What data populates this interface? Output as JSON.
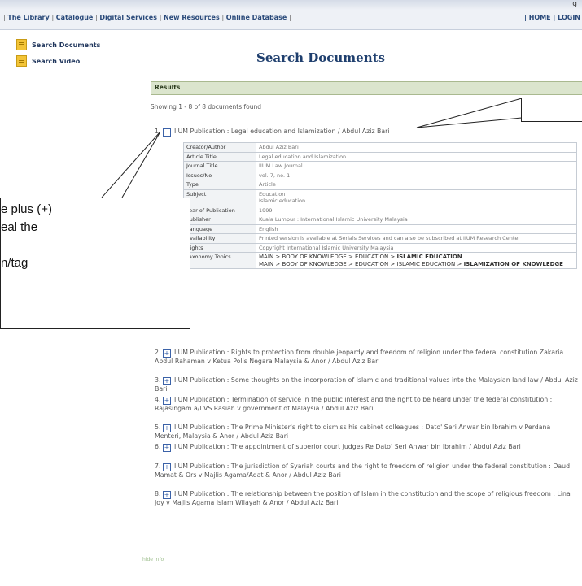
{
  "header": {
    "cutoff_text": "g",
    "nav": [
      "The Library",
      "Catalogue",
      "Digital Services",
      "New Resources",
      "Online Database"
    ],
    "right_links": [
      "HOME",
      "LOGIN"
    ]
  },
  "sidebar": {
    "items": [
      {
        "label": "Search Documents",
        "icon": "document-icon"
      },
      {
        "label": "Search Video",
        "icon": "document-icon"
      }
    ]
  },
  "main": {
    "title": "Search Documents",
    "results_header": "Results",
    "showing": "Showing 1 - 8 of 8 documents found"
  },
  "results": [
    {
      "num": "1.",
      "text": "IIUM Publication : Legal education and Islamization / Abdul Aziz Bari"
    },
    {
      "num": "2.",
      "text": "IIUM Publication : Rights to protection from double jeopardy and freedom of religion under the federal constitution Zakaria Abdul Rahaman v Ketua Polis Negara Malaysia & Anor / Abdul Aziz Bari"
    },
    {
      "num": "3.",
      "text": "IIUM Publication : Some thoughts on the incorporation of Islamic and traditional values into the Malaysian land law / Abdul Aziz Bari"
    },
    {
      "num": "4.",
      "text": "IIUM Publication : Termination of service in the public interest and the right to be heard under the federal constitution : Rajasingam a/l VS Rasiah v government of Malaysia / Abdul Aziz Bari"
    },
    {
      "num": "5.",
      "text": "IIUM Publication : The Prime Minister's right to dismiss his cabinet colleagues : Dato' Seri Anwar bin Ibrahim v Perdana Menteri, Malaysia & Anor / Abdul Aziz Bari"
    },
    {
      "num": "6.",
      "text": "IIUM Publication : The appointment of superior court judges Re Dato' Seri Anwar bin Ibrahim / Abdul Aziz Bari"
    },
    {
      "num": "7.",
      "text": "IIUM Publication : The jurisdiction of Syariah courts and the right to freedom of religion under the federal constitution : Daud Mamat & Ors v Majlis Agama/Adat & Anor / Abdul Aziz Bari"
    },
    {
      "num": "8.",
      "text": "IIUM Publication : The relationship between the position of Islam in the constitution and the scope of religious freedom : Lina Joy v Majlis Agama Islam Wilayah & Anor / Abdul Aziz Bari"
    }
  ],
  "details": [
    {
      "label": "Creator/Author",
      "value": "Abdul Aziz Bari"
    },
    {
      "label": "Article Title",
      "value": "Legal education and Islamization"
    },
    {
      "label": "Journal Title",
      "value": "IIUM Law Journal"
    },
    {
      "label": "Issues/No",
      "value": "vol. 7, no. 1"
    },
    {
      "label": "Type",
      "value": "Article"
    },
    {
      "label": "Subject",
      "value": "Education",
      "value2": "Islamic education"
    },
    {
      "label": "Year of Publication",
      "value": "1999"
    },
    {
      "label": "Publisher",
      "value": "Kuala Lumpur : International Islamic University Malaysia"
    },
    {
      "label": "Language",
      "value": "English"
    },
    {
      "label": "Availability",
      "value": "Printed version is available at Serials Services and can also be subscribed at IIUM Research Center"
    },
    {
      "label": "Rights",
      "value": "Copyright International Islamic University Malaysia"
    },
    {
      "label": "Taxonomy Topics",
      "tax1_prefix": "MAIN > BODY OF KNOWLEDGE > EDUCATION > ",
      "tax1_bold": "ISLAMIC EDUCATION",
      "tax2_prefix": "MAIN > BODY OF KNOWLEDGE > EDUCATION > ISLAMIC EDUCATION > ",
      "tax2_bold": "ISLAMIZATION OF KNOWLEDGE"
    }
  ],
  "callout": {
    "lines": [
      "e plus (+)",
      "eal the",
      "",
      "n/tag"
    ]
  },
  "footer": {
    "text": "hide info"
  }
}
